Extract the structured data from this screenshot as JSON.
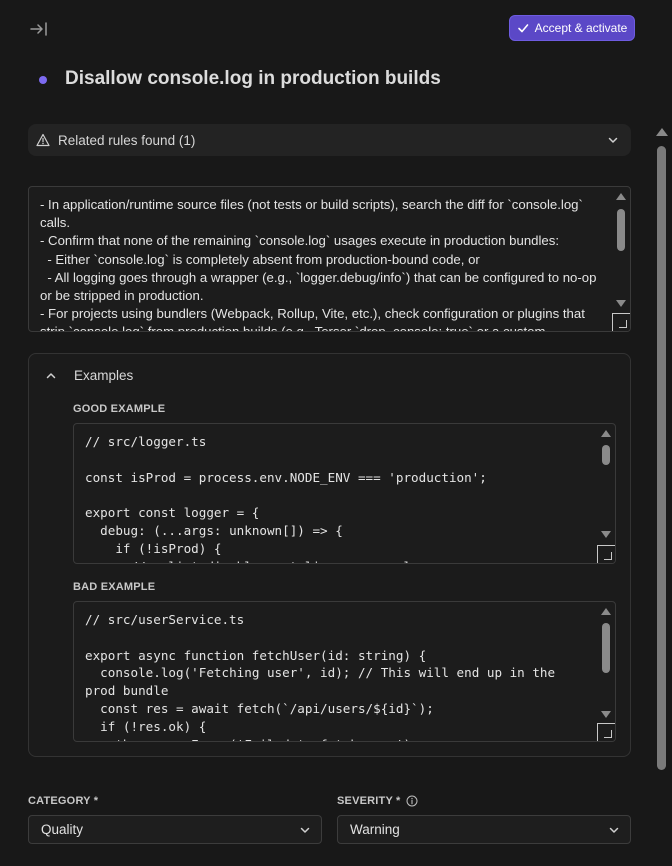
{
  "header": {
    "accept_label": "Accept & activate",
    "accept_color": "#5b48c7"
  },
  "rule": {
    "title": "Disallow console.log in production builds",
    "status_dot_color": "#7c6af0"
  },
  "related": {
    "label": "Related rules found (1)"
  },
  "description": {
    "text": "- In application/runtime source files (not tests or build scripts), search the diff for `console.log` calls.\n- Confirm that none of the remaining `console.log` usages execute in production bundles:\n  - Either `console.log` is completely absent from production-bound code, or\n  - All logging goes through a wrapper (e.g., `logger.debug/info`) that can be configured to no-op or be stripped in production.\n- For projects using bundlers (Webpack, Rollup, Vite, etc.), check configuration or plugins that strip `console.log` from production builds (e.g., Terser `drop_console: true` or a custom"
  },
  "examples": {
    "heading": "Examples",
    "good_label": "GOOD EXAMPLE",
    "good_code": "// src/logger.ts\n\nconst isProd = process.env.NODE_ENV === 'production';\n\nexport const logger = {\n  debug: (...args: unknown[]) => {\n    if (!isProd) {\n      // eslint-disable-next-line no-console",
    "bad_label": "BAD EXAMPLE",
    "bad_code": "// src/userService.ts\n\nexport async function fetchUser(id: string) {\n  console.log('Fetching user', id); // This will end up in the prod bundle\n  const res = await fetch(`/api/users/${id}`);\n  if (!res.ok) {\n    throw new Error('Failed to fetch user');"
  },
  "category": {
    "label": "CATEGORY *",
    "value": "Quality"
  },
  "severity": {
    "label": "SEVERITY *",
    "value": "Warning"
  }
}
